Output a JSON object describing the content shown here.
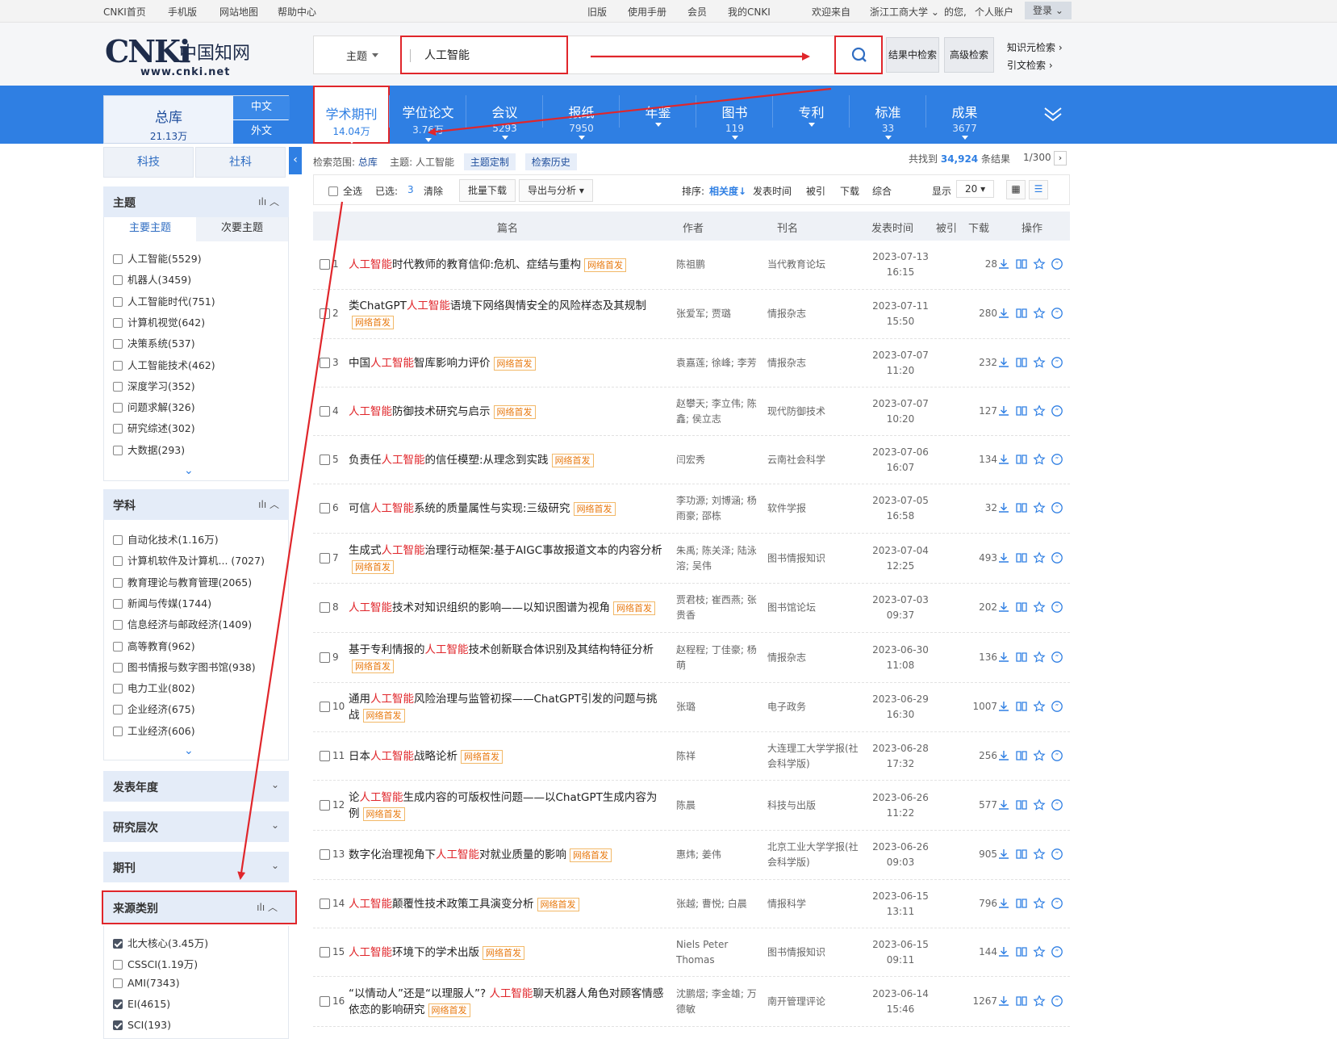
{
  "topbar": {
    "home": "CNKI首页",
    "mobile": "手机版",
    "sitemap": "网站地图",
    "help": "帮助中心",
    "old": "旧版",
    "manual": "使用手册",
    "member": "会员",
    "mycnki": "我的CNKI",
    "welcome": "欢迎来自",
    "org": "浙江工商大学",
    "yours": "的您,",
    "account": "个人账户",
    "login": "登录"
  },
  "logo": {
    "cn": "中国知网",
    "url": "www.cnki.net"
  },
  "search": {
    "field": "主题",
    "query": "人工智能",
    "within": "结果中检索",
    "advanced": "高级检索",
    "knowledge": "知识元检索",
    "citation": "引文检索"
  },
  "total": {
    "label": "总库",
    "count": "21.13万",
    "zh": "中文",
    "wai": "外文"
  },
  "nav_tabs": [
    {
      "label": "学术期刊",
      "count": "14.04万"
    },
    {
      "label": "学位论文",
      "count": "3.76万"
    },
    {
      "label": "会议",
      "count": "5293"
    },
    {
      "label": "报纸",
      "count": "7950"
    },
    {
      "label": "年鉴",
      "count": ""
    },
    {
      "label": "图书",
      "count": "119"
    },
    {
      "label": "专利",
      "count": ""
    },
    {
      "label": "标准",
      "count": "33"
    },
    {
      "label": "成果",
      "count": "3677"
    }
  ],
  "sub_tabs": {
    "sci": "科技",
    "soc": "社科"
  },
  "facets": {
    "topic": {
      "title": "主题",
      "main": "主要主题",
      "secondary": "次要主题",
      "items": [
        "人工智能(5529)",
        "机器人(3459)",
        "人工智能时代(751)",
        "计算机视觉(642)",
        "决策系统(537)",
        "人工智能技术(462)",
        "深度学习(352)",
        "问题求解(326)",
        "研究综述(302)",
        "大数据(293)"
      ]
    },
    "subject": {
      "title": "学科",
      "items": [
        "自动化技术(1.16万)",
        "计算机软件及计算机... (7027)",
        "教育理论与教育管理(2065)",
        "新闻与传媒(1744)",
        "信息经济与邮政经济(1409)",
        "高等教育(962)",
        "图书情报与数字图书馆(938)",
        "电力工业(802)",
        "企业经济(675)",
        "工业经济(606)"
      ]
    },
    "year": "发表年度",
    "level": "研究层次",
    "journal": "期刊",
    "source": {
      "title": "来源类别",
      "items": [
        {
          "label": "北大核心(3.45万)",
          "checked": true
        },
        {
          "label": "CSSCI(1.19万)",
          "checked": false
        },
        {
          "label": "AMI(7343)",
          "checked": false
        },
        {
          "label": "EI(4615)",
          "checked": true
        },
        {
          "label": "SCI(193)",
          "checked": true
        }
      ]
    }
  },
  "scope": {
    "label": "检索范围:",
    "db": "总库",
    "topic_label": "主题:",
    "topic": "人工智能",
    "custom": "主题定制",
    "history": "检索历史"
  },
  "results": {
    "prefix": "共找到",
    "count": "34,924",
    "suffix": "条结果",
    "page": "1/300"
  },
  "toolbar": {
    "select_all": "全选",
    "selected_label": "已选:",
    "selected": "3",
    "clear": "清除",
    "batch": "批量下载",
    "export": "导出与分析",
    "sort_label": "排序:",
    "relevance": "相关度",
    "pubtime": "发表时间",
    "cited": "被引",
    "download": "下载",
    "overall": "综合",
    "show_label": "显示",
    "show": "20"
  },
  "columns": {
    "title": "篇名",
    "author": "作者",
    "journal": "刊名",
    "date": "发表时间",
    "cited": "被引",
    "downloads": "下载",
    "ops": "操作"
  },
  "badge": "网络首发",
  "rows": [
    {
      "no": "1",
      "pre": "",
      "hl": "人工智能",
      "post": "时代教师的教育信仰:危机、症结与重构",
      "authors": "陈祖鹏",
      "journal": "当代教育论坛",
      "date": "2023-07-13",
      "time": "16:15",
      "downloads": "28"
    },
    {
      "no": "2",
      "pre": "类ChatGPT",
      "hl": "人工智能",
      "post": "语境下网络舆情安全的风险样态及其规制",
      "authors": "张爱军; 贾璐",
      "journal": "情报杂志",
      "date": "2023-07-11",
      "time": "15:50",
      "downloads": "280"
    },
    {
      "no": "3",
      "pre": "中国",
      "hl": "人工智能",
      "post": "智库影响力评价",
      "authors": "袁嘉莲; 徐峰; 李芳",
      "journal": "情报杂志",
      "date": "2023-07-07",
      "time": "11:20",
      "downloads": "232"
    },
    {
      "no": "4",
      "pre": "",
      "hl": "人工智能",
      "post": "防御技术研究与启示",
      "authors": "赵攀天; 李立伟; 陈鑫; 侯立志",
      "journal": "现代防御技术",
      "date": "2023-07-07",
      "time": "10:20",
      "downloads": "127"
    },
    {
      "no": "5",
      "pre": "负责任",
      "hl": "人工智能",
      "post": "的信任模塑:从理念到实践",
      "authors": "闫宏秀",
      "journal": "云南社会科学",
      "date": "2023-07-06",
      "time": "16:07",
      "downloads": "134"
    },
    {
      "no": "6",
      "pre": "可信",
      "hl": "人工智能",
      "post": "系统的质量属性与实现:三级研究",
      "authors": "李功源; 刘博涵; 杨雨豪; 邵栋",
      "journal": "软件学报",
      "date": "2023-07-05",
      "time": "16:58",
      "downloads": "32"
    },
    {
      "no": "7",
      "pre": "生成式",
      "hl": "人工智能",
      "post": "治理行动框架:基于AIGC事故报道文本的内容分析",
      "authors": "朱禹; 陈关泽; 陆泳溶; 吴伟",
      "journal": "图书情报知识",
      "date": "2023-07-04",
      "time": "12:25",
      "downloads": "493"
    },
    {
      "no": "8",
      "pre": "",
      "hl": "人工智能",
      "post": "技术对知识组织的影响——以知识图谱为视角",
      "authors": "贾君枝; 崔西燕; 张贵香",
      "journal": "图书馆论坛",
      "date": "2023-07-03",
      "time": "09:37",
      "downloads": "202"
    },
    {
      "no": "9",
      "pre": "基于专利情报的",
      "hl": "人工智能",
      "post": "技术创新联合体识别及其结构特征分析",
      "authors": "赵程程; 丁佳豪; 杨萌",
      "journal": "情报杂志",
      "date": "2023-06-30",
      "time": "11:08",
      "downloads": "136"
    },
    {
      "no": "10",
      "pre": "通用",
      "hl": "人工智能",
      "post": "风险治理与监管初探——ChatGPT引发的问题与挑战",
      "authors": "张璐",
      "journal": "电子政务",
      "date": "2023-06-29",
      "time": "16:30",
      "downloads": "1007"
    },
    {
      "no": "11",
      "pre": "日本",
      "hl": "人工智能",
      "post": "战略论析",
      "authors": "陈祥",
      "journal": "大连理工大学学报(社会科学版)",
      "date": "2023-06-28",
      "time": "17:32",
      "downloads": "256"
    },
    {
      "no": "12",
      "pre": "论",
      "hl": "人工智能",
      "post": "生成内容的可版权性问题——以ChatGPT生成内容为例",
      "authors": "陈晨",
      "journal": "科技与出版",
      "date": "2023-06-26",
      "time": "11:22",
      "downloads": "577"
    },
    {
      "no": "13",
      "pre": "数字化治理视角下",
      "hl": "人工智能",
      "post": "对就业质量的影响",
      "authors": "惠炜; 姜伟",
      "journal": "北京工业大学学报(社会科学版)",
      "date": "2023-06-26",
      "time": "09:03",
      "downloads": "905"
    },
    {
      "no": "14",
      "pre": "",
      "hl": "人工智能",
      "post": "颠覆性技术政策工具演变分析",
      "authors": "张越; 曹悦; 白晨",
      "journal": "情报科学",
      "date": "2023-06-15",
      "time": "13:11",
      "downloads": "796"
    },
    {
      "no": "15",
      "pre": "",
      "hl": "人工智能",
      "post": "环境下的学术出版",
      "authors": "Niels Peter Thomas",
      "journal": "图书情报知识",
      "date": "2023-06-15",
      "time": "09:11",
      "downloads": "144"
    },
    {
      "no": "16",
      "pre": "“以情动人”还是“以理服人”? ",
      "hl": "人工智能",
      "post": "聊天机器人角色对顾客情感依恋的影响研究",
      "authors": "沈鹏熠; 李金雄; 万德敏",
      "journal": "南开管理评论",
      "date": "2023-06-14",
      "time": "15:46",
      "downloads": "1267"
    }
  ]
}
